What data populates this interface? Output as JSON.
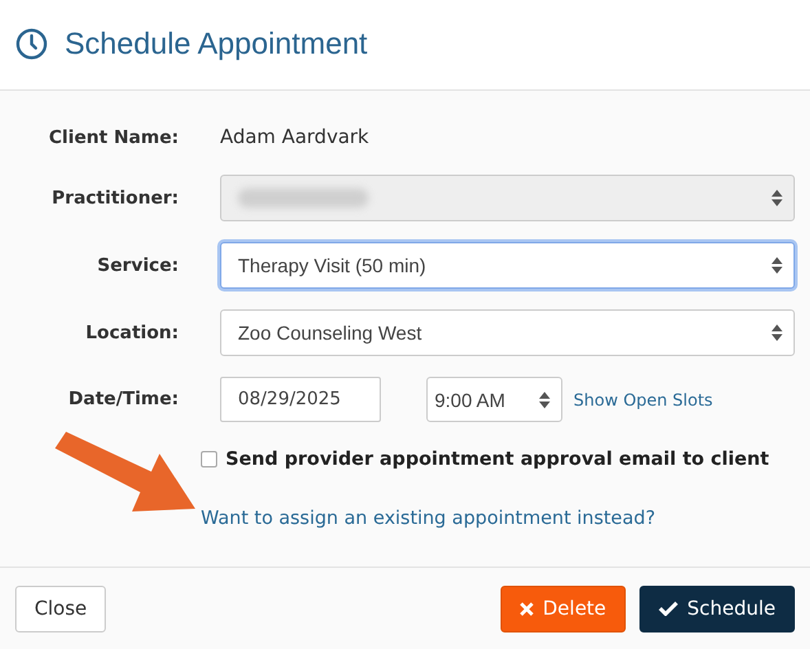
{
  "dialog": {
    "title": "Schedule Appointment"
  },
  "rows": [
    {
      "kind": "text",
      "label": "Client Name:",
      "value": "Adam Aardvark"
    },
    {
      "kind": "select",
      "label": "Practitioner:",
      "disabled": true,
      "value_hidden": true,
      "focused": false
    },
    {
      "kind": "select",
      "label": "Service:",
      "value": "Therapy Visit (50 min)",
      "disabled": false,
      "focused": true
    },
    {
      "kind": "select",
      "label": "Location:",
      "value": "Zoo Counseling West",
      "disabled": false,
      "focused": false
    },
    {
      "kind": "datetime",
      "label": "Date/Time:",
      "date": "08/29/2025",
      "time": "9:00 AM",
      "link": "Show Open Slots"
    }
  ],
  "approval_email": {
    "label": "Send provider appointment approval email to client",
    "checked": false
  },
  "assign_link": "Want to assign an existing appointment instead?",
  "annotation": {
    "kind": "arrow"
  },
  "buttons": [
    {
      "kind": "default",
      "label": "Close"
    },
    {
      "kind": "danger",
      "label": "Delete"
    },
    {
      "kind": "primary",
      "label": "Schedule"
    }
  ]
}
